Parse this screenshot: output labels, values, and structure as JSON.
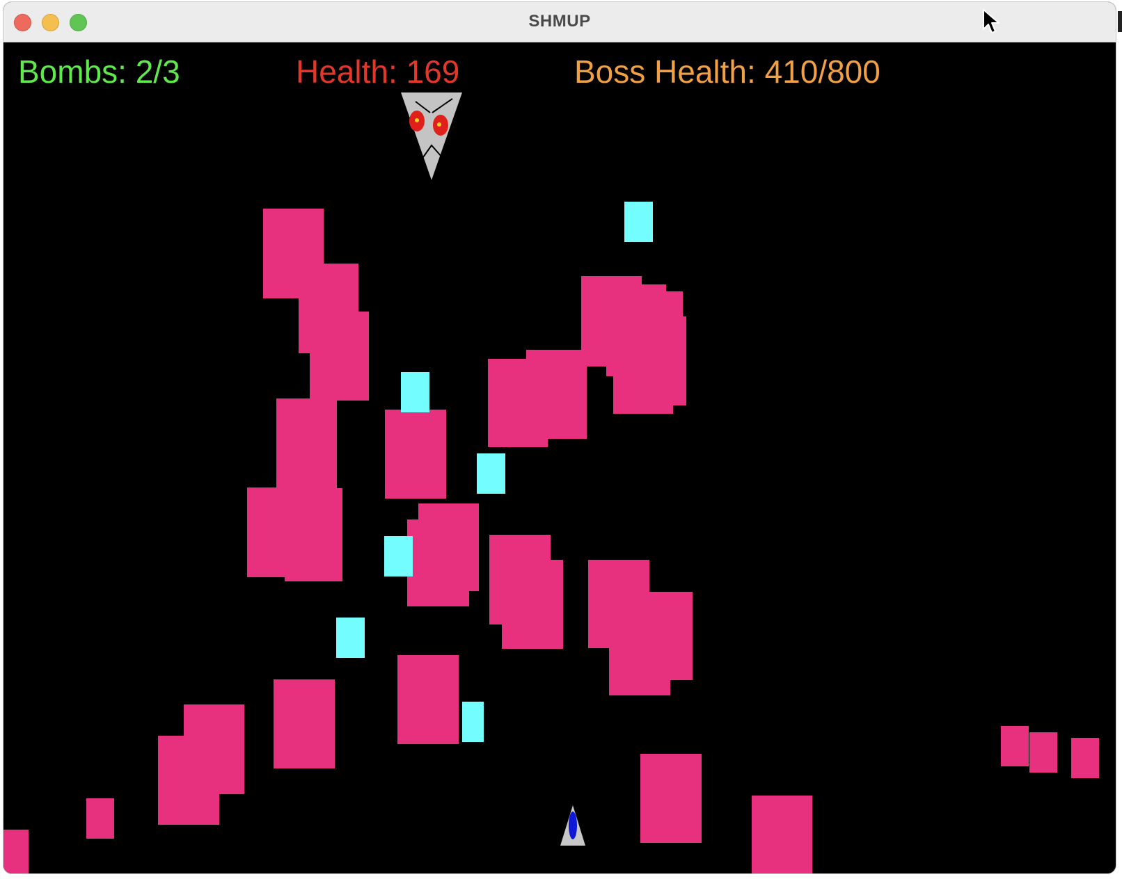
{
  "window": {
    "title": "SHMUP"
  },
  "hud": {
    "bombs_text": "Bombs: 2/3",
    "health_text": "Health: 169",
    "boss_health_text": "Boss Health: 410/800"
  },
  "game_state": {
    "bombs": 2,
    "bombs_max": 3,
    "player_health": 169,
    "boss_health": 410,
    "boss_health_max": 800
  },
  "colors": {
    "background": "#000000",
    "bombs": "#5eea4b",
    "health": "#e3372a",
    "boss_health": "#f1a043",
    "enemy": "#e8317e",
    "enemy_bullet": "#73fdfe",
    "boss_body": "#c4c4c4",
    "boss_eye": "#e0201a",
    "boss_pupil": "#f4d020",
    "player_body": "#c8c8c8",
    "player_cockpit": "#1018d8"
  },
  "icons": {
    "boss": "boss-ship-icon",
    "player": "player-ship-icon",
    "cursor": "mouse-cursor-icon"
  }
}
